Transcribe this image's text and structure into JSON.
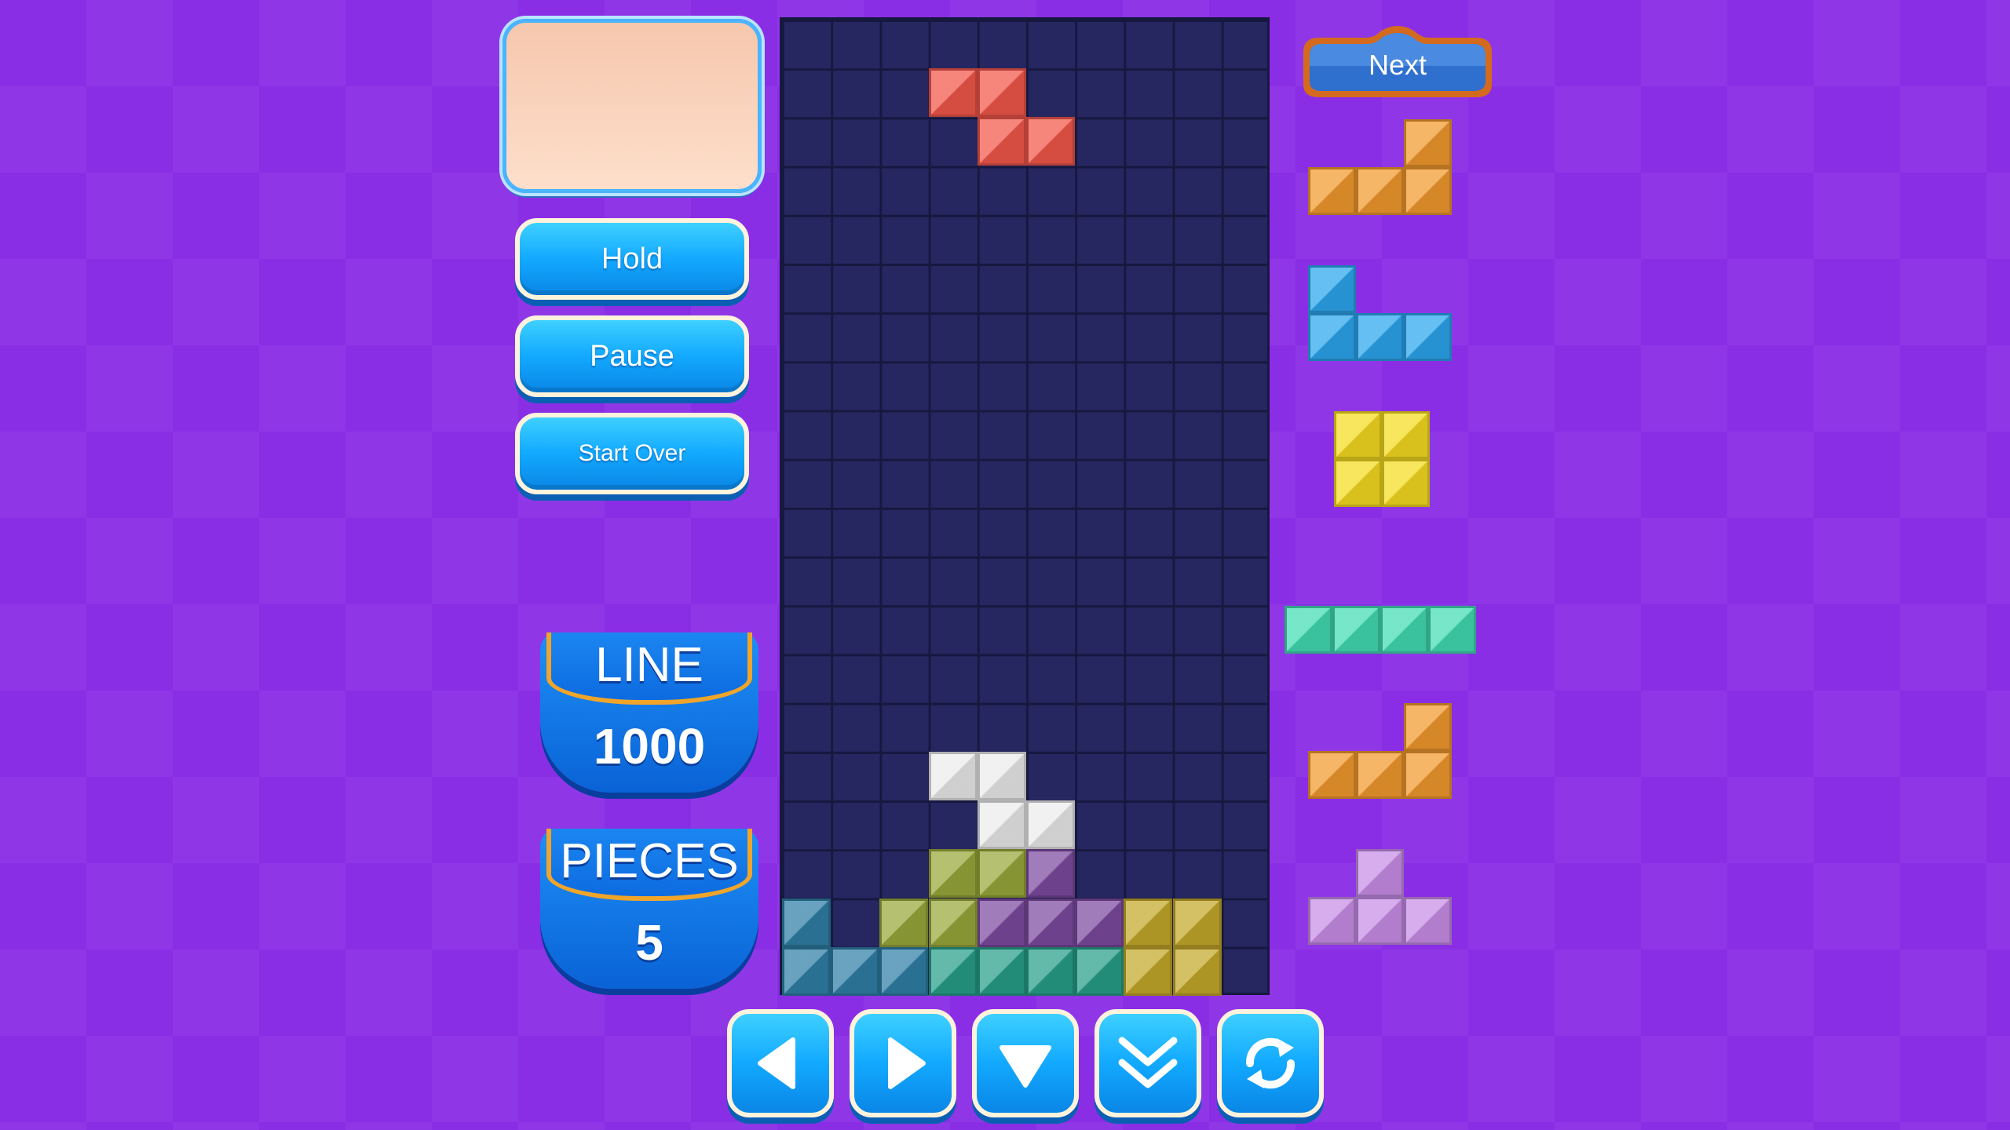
{
  "hold": {
    "label": "Hold"
  },
  "pause": {
    "label": "Pause"
  },
  "start_over": {
    "label": "Start Over"
  },
  "stats": {
    "line": {
      "title": "LINE",
      "value": "1000"
    },
    "pieces": {
      "title": "PIECES",
      "value": "5"
    }
  },
  "next": {
    "label": "Next"
  },
  "colors": {
    "red": "#f2564a",
    "white": "#ececec",
    "olive": "#9aa83a",
    "purple_dark": "#7d4aa0",
    "teal_blue": "#2f7fa6",
    "teal_green": "#279f8a",
    "gold": "#c4a92a",
    "orange": "#f39a2e",
    "blue": "#2ba6ee",
    "yellow": "#f6dc20",
    "aqua": "#42dcb4",
    "lavender": "#c98ee8"
  },
  "board": {
    "columns": 10,
    "rows": 20,
    "active_piece": {
      "color": "red",
      "cells": [
        [
          3,
          1
        ],
        [
          4,
          1
        ],
        [
          4,
          2
        ],
        [
          5,
          2
        ]
      ]
    },
    "locked_cells": [
      {
        "c": 3,
        "r": 15,
        "color": "white"
      },
      {
        "c": 4,
        "r": 15,
        "color": "white"
      },
      {
        "c": 4,
        "r": 16,
        "color": "white"
      },
      {
        "c": 5,
        "r": 16,
        "color": "white"
      },
      {
        "c": 3,
        "r": 17,
        "color": "olive"
      },
      {
        "c": 4,
        "r": 17,
        "color": "olive"
      },
      {
        "c": 5,
        "r": 17,
        "color": "purple_dark"
      },
      {
        "c": 0,
        "r": 18,
        "color": "teal_blue"
      },
      {
        "c": 2,
        "r": 18,
        "color": "olive"
      },
      {
        "c": 3,
        "r": 18,
        "color": "olive"
      },
      {
        "c": 4,
        "r": 18,
        "color": "purple_dark"
      },
      {
        "c": 5,
        "r": 18,
        "color": "purple_dark"
      },
      {
        "c": 6,
        "r": 18,
        "color": "purple_dark"
      },
      {
        "c": 7,
        "r": 18,
        "color": "gold"
      },
      {
        "c": 8,
        "r": 18,
        "color": "gold"
      },
      {
        "c": 0,
        "r": 19,
        "color": "teal_blue"
      },
      {
        "c": 1,
        "r": 19,
        "color": "teal_blue"
      },
      {
        "c": 2,
        "r": 19,
        "color": "teal_blue"
      },
      {
        "c": 3,
        "r": 19,
        "color": "teal_green"
      },
      {
        "c": 4,
        "r": 19,
        "color": "teal_green"
      },
      {
        "c": 5,
        "r": 19,
        "color": "teal_green"
      },
      {
        "c": 6,
        "r": 19,
        "color": "teal_green"
      },
      {
        "c": 7,
        "r": 19,
        "color": "gold"
      },
      {
        "c": 8,
        "r": 19,
        "color": "gold"
      }
    ]
  },
  "next_queue": [
    {
      "shape": "L",
      "color": "orange"
    },
    {
      "shape": "J",
      "color": "blue"
    },
    {
      "shape": "O",
      "color": "yellow"
    },
    {
      "shape": "I",
      "color": "aqua"
    },
    {
      "shape": "L",
      "color": "orange"
    },
    {
      "shape": "T",
      "color": "lavender"
    }
  ],
  "controls": [
    {
      "name": "move-left-button",
      "icon": "left-arrow-icon"
    },
    {
      "name": "move-right-button",
      "icon": "right-arrow-icon"
    },
    {
      "name": "soft-drop-button",
      "icon": "down-triangle-icon"
    },
    {
      "name": "hard-drop-button",
      "icon": "double-chevron-down-icon"
    },
    {
      "name": "rotate-button",
      "icon": "rotate-icon"
    }
  ]
}
